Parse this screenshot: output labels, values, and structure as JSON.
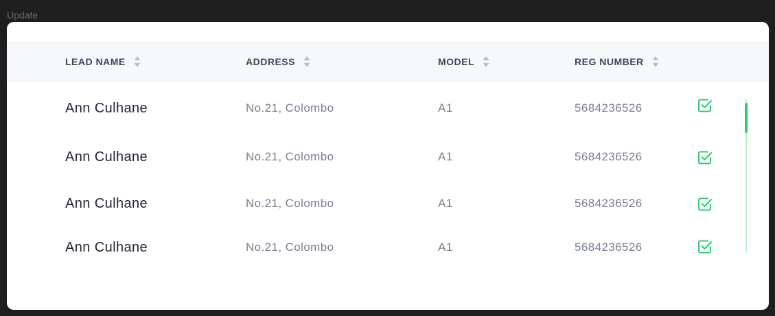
{
  "frame": {
    "label": "Update"
  },
  "table": {
    "columns": [
      {
        "label": "LEAD NAME"
      },
      {
        "label": "ADDRESS"
      },
      {
        "label": "MODEL"
      },
      {
        "label": "REG NUMBER"
      }
    ],
    "rows": [
      {
        "lead_name": "Ann Culhane",
        "address": "No.21, Colombo",
        "model": "A1",
        "reg_number": "5684236526",
        "checked": true
      },
      {
        "lead_name": "Ann Culhane",
        "address": "No.21, Colombo",
        "model": "A1",
        "reg_number": "5684236526",
        "checked": true
      },
      {
        "lead_name": "Ann Culhane",
        "address": "No.21, Colombo",
        "model": "A1",
        "reg_number": "5684236526",
        "checked": true
      },
      {
        "lead_name": "Ann Culhane",
        "address": "No.21, Colombo",
        "model": "A1",
        "reg_number": "5684236526",
        "checked": true
      }
    ]
  },
  "colors": {
    "accent_green": "#2ecc71",
    "header_bg": "#f6f8fc",
    "sort_icon": "#b8bfcc"
  },
  "icons": {
    "sort": "sort-arrows-icon",
    "row_action": "checkbox-checked-icon"
  }
}
